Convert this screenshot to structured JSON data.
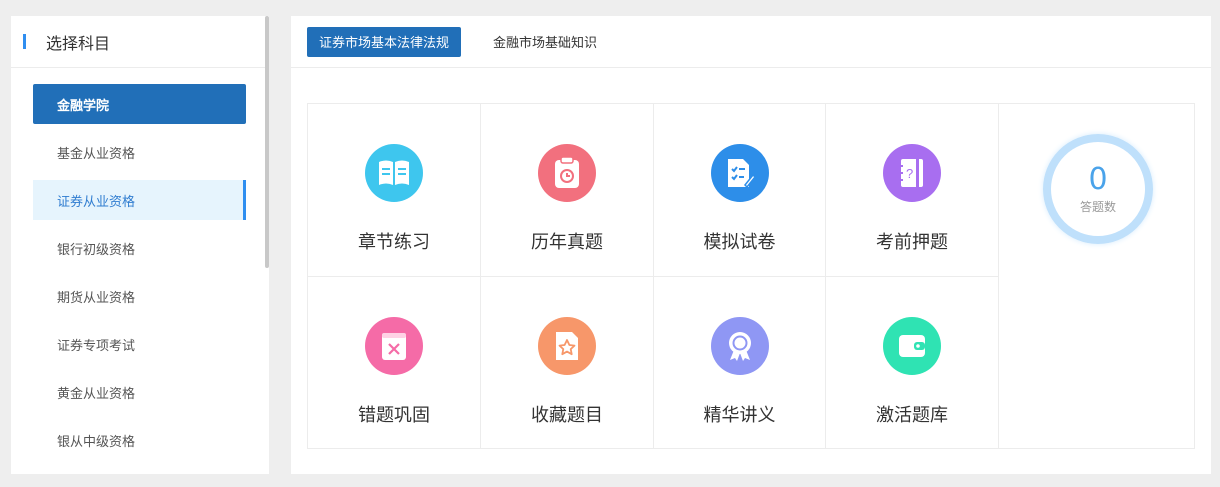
{
  "sidebar": {
    "title": "选择科目",
    "items": [
      {
        "label": "金融学院"
      },
      {
        "label": "基金从业资格"
      },
      {
        "label": "证券从业资格"
      },
      {
        "label": "银行初级资格"
      },
      {
        "label": "期货从业资格"
      },
      {
        "label": "证券专项考试"
      },
      {
        "label": "黄金从业资格"
      },
      {
        "label": "银从中级资格"
      }
    ]
  },
  "tabs": [
    {
      "label": "证券市场基本法律法规",
      "active": true
    },
    {
      "label": "金融市场基础知识",
      "active": false
    }
  ],
  "features": [
    {
      "label": "章节练习",
      "icon": "book-icon",
      "color": "#3ec6ee"
    },
    {
      "label": "历年真题",
      "icon": "clipboard-icon",
      "color": "#f2707e"
    },
    {
      "label": "模拟试卷",
      "icon": "exam-paper-icon",
      "color": "#2d8ee9"
    },
    {
      "label": "考前押题",
      "icon": "question-notebook-icon",
      "color": "#a86ef0"
    },
    {
      "label": "错题巩固",
      "icon": "wrong-book-icon",
      "color": "#f56ba7"
    },
    {
      "label": "收藏题目",
      "icon": "star-document-icon",
      "color": "#f7976a"
    },
    {
      "label": "精华讲义",
      "icon": "award-icon",
      "color": "#8f97f4"
    },
    {
      "label": "激活题库",
      "icon": "wallet-icon",
      "color": "#2fe3b3"
    }
  ],
  "stats": {
    "count": "0",
    "label": "答题数"
  },
  "colors": {
    "accent": "#216fb8",
    "highlight_bg": "#e6f4fd",
    "highlight_bar": "#2f8ef0"
  }
}
